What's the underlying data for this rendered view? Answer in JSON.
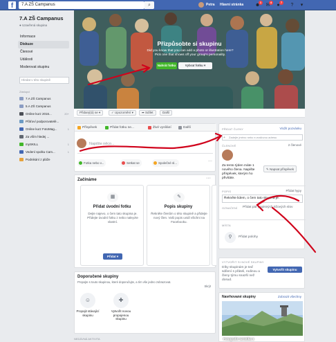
{
  "topbar": {
    "search_value": "7.A ZŠ Campanus",
    "user_name": "Petra",
    "home_label": "Hlavní stránka",
    "friend_badge": "1",
    "msg_badge": "4",
    "notif_badge": "7"
  },
  "sidebar": {
    "group_name": "7.A ZŠ Campanus",
    "group_privacy": "Uzavřená skupina",
    "nav": [
      "Informace",
      "Diskuze",
      "Členové",
      "Události",
      "Moderovat skupinu"
    ],
    "search_placeholder": "Hledat v této skupině",
    "shortcuts_label": "Zástupci",
    "shortcuts": [
      {
        "label": "7.A ZŠ Campanus",
        "count": "",
        "color": "#8b9dc3"
      },
      {
        "label": "5.A ZŠ Campanus",
        "count": "",
        "color": "#8b9dc3"
      },
      {
        "label": "Online kurz 2016...",
        "count": "20+",
        "color": "#4b4f56"
      },
      {
        "label": "Přáťoví podporovatelé...",
        "count": "",
        "color": "#6b9ac4"
      },
      {
        "label": "Online kurz FotoMag...",
        "count": "1",
        "color": "#4267b2"
      },
      {
        "label": "Za vším hledej ...",
        "count": "",
        "color": "#606770"
      },
      {
        "label": "mySKILL",
        "count": "1",
        "color": "#42b72a"
      },
      {
        "label": "Vedení spolku Cam...",
        "count": "1",
        "color": "#4267b2"
      },
      {
        "label": "Podnikání z pláže",
        "count": "",
        "color": "#e6a23c"
      }
    ]
  },
  "cover": {
    "title": "Přizpůsobte si skupinu",
    "desc_1": "Did you know that you can add a photo or illustration here?",
    "desc_2": "Pick one that shows off your group's personality.",
    "upload_label": "Nahrát fotku",
    "choose_label": "Vybrat fotku",
    "joined_label": "Přidaný(á) se",
    "notif_label": "Upozornění",
    "share_label": "Sdílet",
    "more_label": "Další"
  },
  "composer": {
    "tabs": [
      "Příspěvek",
      "Přidat fotku ne...",
      "Živé vysílání",
      "Další"
    ],
    "placeholder": "Napište něco...",
    "chips": [
      "Fotka nebo v...",
      "Setkat se",
      "Společné sl..."
    ]
  },
  "start": {
    "title": "Začínáme",
    "cards": [
      {
        "title": "Přidat úvodní fotku",
        "body": "Dejte najevo, o čem tato skupina je. Přidejte úvodní fotku z nebo naleyzte vlastní.",
        "btn": "Přidat"
      },
      {
        "title": "Popis skupiny",
        "body": "Řekněte členům o této skupině a přidejte nový člen. Vaši popis uvidí všichni na Facebooku.",
        "btn": ""
      }
    ]
  },
  "suggested": {
    "title": "Doporučené skupiny",
    "desc": "Propojte s touto skupinou, které doporučujte, a tím vše jedno zobrazovat.",
    "see_all": "Skrýt",
    "items": [
      "Propojit stávající skupinu",
      "Vytvořit novou propojenou skupinu"
    ],
    "recent_label": "NEDÁVNÁ AKTIVITA"
  },
  "right": {
    "add_members_label": "Přidat členy",
    "invite_link": "Vložit pozvánku",
    "add_members_placeholder": "Zadejte jméno nebo e-mailovou adresu",
    "members_count": "2 členové",
    "new_member_text": "Za tento týden máte 1 nového člena. Napište příspěvek, kterým ho přivítáte.",
    "welcome_btn": "Napsat příspěvek",
    "desc_label": "Popis",
    "desc_link": "Přidat hypy",
    "desc_value": "Řekněte lidem, o čem tato skupina je.",
    "tags_label": "Označení",
    "tags_value": "Přidat pár popisných ttčových slov",
    "location_label": "Místa",
    "location_value": "Přidat polohy",
    "create_label": "Vytvořit si nové skupiny",
    "create_text": "Díky skupinám je teď sdílení s přáteli, rodinou a členy týmu snazší než dosud.",
    "create_btn": "Vytvořit skupinu",
    "suggest_title": "Navrhované skupiny",
    "suggest_link": "Zobrazit všechny",
    "photo_caption": "Fotografie turistika 1"
  }
}
